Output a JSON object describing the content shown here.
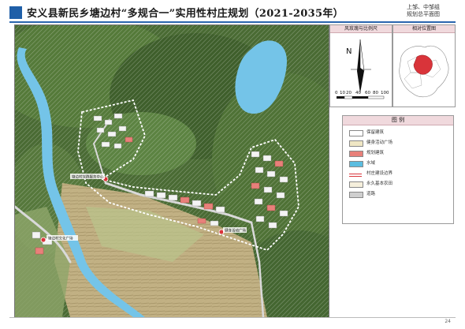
{
  "header": {
    "title": "安义县新民乡塘边村“多规合一”实用性村庄规划（2021-2035年）",
    "right_label_line1": "上邹、中邹组",
    "right_label_line2": "规划总平面图",
    "accent_color": "#1f5fa8"
  },
  "compass_panel": {
    "heading": "风玫瑰与比例尺",
    "north_letter": "N",
    "scale_ticks": [
      "0",
      "10",
      "20",
      "40",
      "60",
      "80",
      "100"
    ]
  },
  "location_panel": {
    "heading": "相对位置图"
  },
  "legend": {
    "heading": "图   例",
    "items": [
      {
        "label": "保留建筑",
        "color": "#ffffff",
        "icon": "retained-building"
      },
      {
        "label": "健身活动广场",
        "color": "#efe6c4",
        "icon": "fitness-square"
      },
      {
        "label": "规划建筑",
        "color": "#e8807a",
        "icon": "planned-building"
      },
      {
        "label": "水域",
        "color": "#5bbde0",
        "icon": "water"
      },
      {
        "label": "村庄建设边界",
        "color": "#d9343a",
        "icon": "boundary-line"
      },
      {
        "label": "永久基本农田",
        "color": "#f5efdc",
        "icon": "farmland"
      },
      {
        "label": "道路",
        "color": "#cfcfcf",
        "icon": "road"
      }
    ]
  },
  "map": {
    "label_a": "塘边村党群服务中心",
    "label_b": "塘边村文化广场",
    "label_c": "健身活动广场"
  },
  "page_number": "24"
}
